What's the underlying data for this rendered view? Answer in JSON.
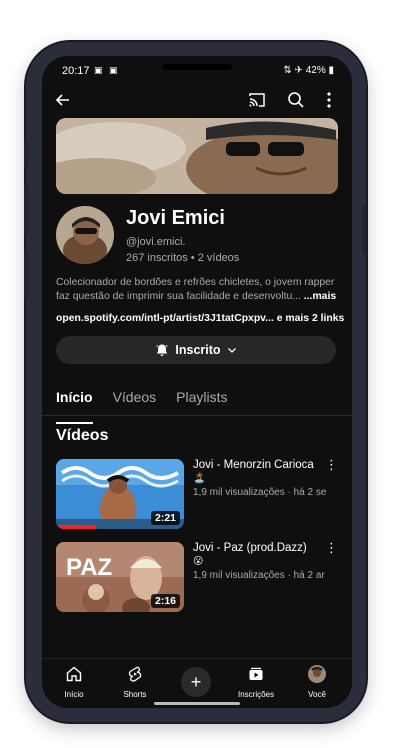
{
  "status_bar": {
    "time": "20:17",
    "battery": "42%"
  },
  "channel": {
    "name": "Jovi Emici",
    "handle": "@jovi.emici.",
    "stats": "267 inscritos • 2 vídeos",
    "description": "Colecionador de bordões e refrões chicletes, o jovem rapper faz questão de imprimir sua facilidade e desenvoltu...",
    "more_label": "...mais",
    "link_text": "open.spotify.com/intl-pt/artist/3J1tatCpxpv...",
    "more_links": "e mais 2 links",
    "subscribe_label": "Inscrito"
  },
  "tabs": [
    {
      "label": "Início",
      "active": true
    },
    {
      "label": "Vídeos",
      "active": false
    },
    {
      "label": "Playlists",
      "active": false
    }
  ],
  "section_title": "Vídeos",
  "videos": [
    {
      "title": "Jovi - Menorzin Carioca",
      "emoji": "🏝️",
      "meta": "1,9 mil visualizações · há 2 se",
      "duration": "2:21"
    },
    {
      "title": "Jovi - Paz (prod.Dazz)",
      "emoji": "😮",
      "meta": "1,9 mil visualizações · há 2 ar",
      "duration": "2:16",
      "thumb_text": "PAZ"
    }
  ],
  "bottom_nav": {
    "home": "Início",
    "shorts": "Shorts",
    "subscriptions": "Inscrições",
    "you": "Você"
  },
  "colors": {
    "background": "#0f0f0f",
    "secondary_text": "#aaaaaa",
    "button_bg": "#272727",
    "phone_frame": "#2b2d3a"
  }
}
